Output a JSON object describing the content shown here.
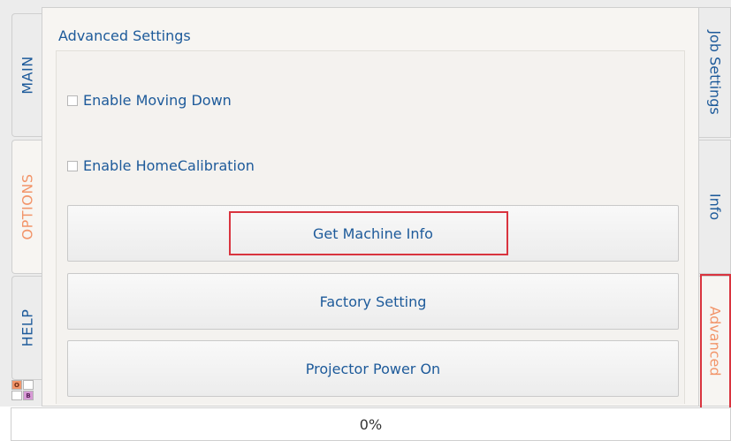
{
  "left_tabs": [
    {
      "label": "MAIN",
      "active": false
    },
    {
      "label": "OPTIONS",
      "active": true
    },
    {
      "label": "HELP",
      "active": false
    }
  ],
  "right_tabs": [
    {
      "label": "Job Settings",
      "active": false
    },
    {
      "label": "Info",
      "active": false
    },
    {
      "label": "Advanced",
      "active": true
    }
  ],
  "panel": {
    "title": "Advanced Settings",
    "checkboxes": [
      {
        "label": "Enable Moving Down",
        "checked": false
      },
      {
        "label": "Enable HomeCalibration",
        "checked": false
      }
    ],
    "buttons": [
      {
        "label": "Get Machine Info"
      },
      {
        "label": "Factory Setting"
      },
      {
        "label": "Projector Power On"
      }
    ]
  },
  "logo": {
    "tile_1": "O",
    "tile_4": "B"
  },
  "status": {
    "progress": "0%"
  },
  "colors": {
    "accent_text": "#1d5a9a",
    "active_tab_text": "#f2956a",
    "highlight_border": "#d9343f"
  }
}
